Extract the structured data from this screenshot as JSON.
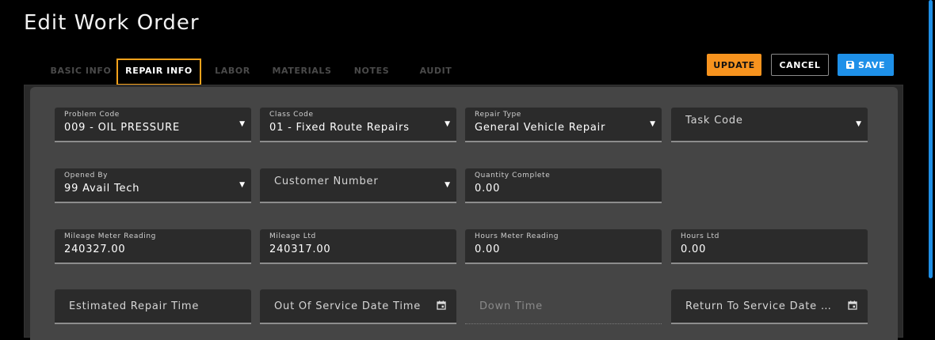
{
  "page": {
    "title": "Edit Work Order"
  },
  "tabs": [
    {
      "label": "BASIC INFO"
    },
    {
      "label": "REPAIR INFO"
    },
    {
      "label": "LABOR"
    },
    {
      "label": "MATERIALS"
    },
    {
      "label": "NOTES"
    },
    {
      "label": "AUDIT"
    }
  ],
  "toolbar": {
    "update_label": "UPDATE",
    "cancel_label": "CANCEL",
    "save_label": "SAVE"
  },
  "form": {
    "problem_code": {
      "label": "Problem Code",
      "value": "009 - OIL PRESSURE"
    },
    "class_code": {
      "label": "Class Code",
      "value": "01 - Fixed Route Repairs"
    },
    "repair_type": {
      "label": "Repair Type",
      "value": "General Vehicle Repair"
    },
    "task_code": {
      "placeholder": "Task Code"
    },
    "opened_by": {
      "label": "Opened By",
      "value": "99 Avail Tech"
    },
    "customer_number": {
      "placeholder": "Customer Number"
    },
    "quantity_complete": {
      "label": "Quantity Complete",
      "value": "0.00"
    },
    "mileage_meter_reading": {
      "label": "Mileage Meter Reading",
      "value": "240327.00"
    },
    "mileage_ltd": {
      "label": "Mileage Ltd",
      "value": "240317.00"
    },
    "hours_meter_reading": {
      "label": "Hours Meter Reading",
      "value": "0.00"
    },
    "hours_ltd": {
      "label": "Hours Ltd",
      "value": "0.00"
    },
    "estimated_repair_time": {
      "placeholder": "Estimated Repair Time"
    },
    "out_of_service": {
      "placeholder": "Out Of Service Date Time"
    },
    "down_time": {
      "placeholder": "Down Time"
    },
    "return_to_service": {
      "placeholder": "Return To Service Date Ti..."
    }
  },
  "colors": {
    "accent_orange": "#f7931e",
    "accent_blue": "#1e90e8",
    "panel_bg": "#454545",
    "field_bg": "#2b2b2b"
  },
  "icons": {
    "dropdown": "caret-down-icon",
    "calendar": "calendar-icon",
    "save": "floppy-disk-icon"
  }
}
